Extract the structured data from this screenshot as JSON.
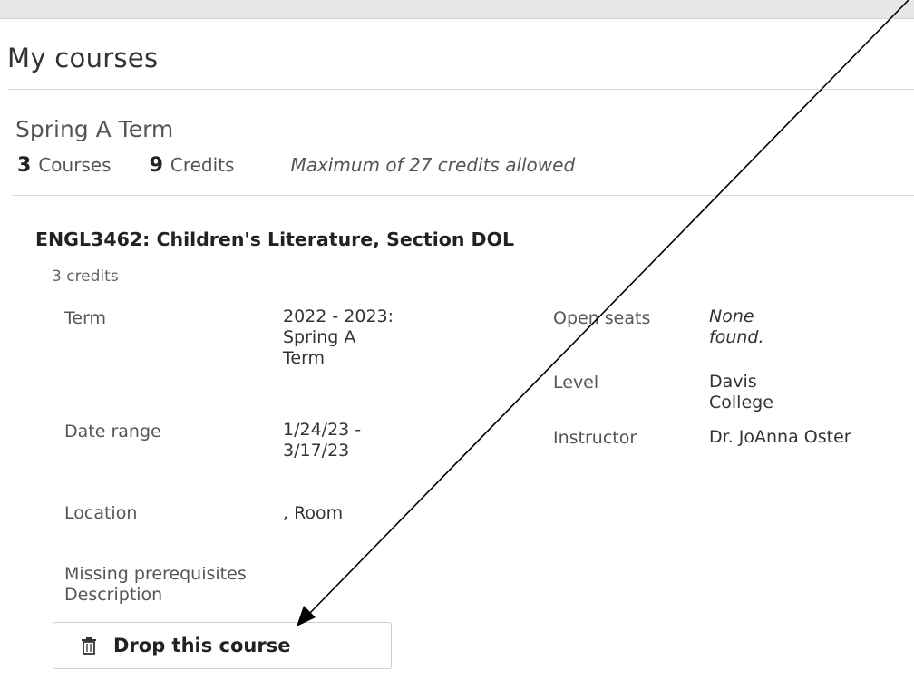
{
  "page": {
    "title": "My courses"
  },
  "term": {
    "name": "Spring A Term",
    "course_count": "3",
    "courses_label": "Courses",
    "credit_count": "9",
    "credits_label": "Credits",
    "max_note": "Maximum of 27 credits allowed"
  },
  "course": {
    "title": "ENGL3462: Children's Literature, Section DOL",
    "credits": "3 credits",
    "details": {
      "term_label": "Term",
      "term_value": "2022 - 2023: Spring A Term",
      "date_range_label": "Date range",
      "date_range_value": "1/24/23 - 3/17/23",
      "location_label": "Location",
      "location_value": ", Room",
      "open_seats_label": "Open seats",
      "open_seats_value": "None found.",
      "level_label": "Level",
      "level_value": "Davis College",
      "instructor_label": "Instructor",
      "instructor_value": "Dr. JoAnna Oster"
    },
    "missing_prereq_label": "Missing prerequisites",
    "description_label": "Description",
    "drop_button_label": "Drop this course",
    "drop_button_icon": "trash-icon"
  }
}
